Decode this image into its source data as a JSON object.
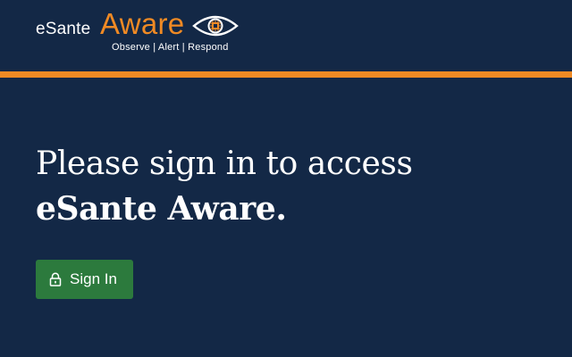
{
  "brand": {
    "prefix": "eSante",
    "name": "Aware",
    "tagline": "Observe | Alert | Respond",
    "colors": {
      "accent": "#f08a24",
      "background": "#132846",
      "button": "#2c7a3d"
    }
  },
  "main": {
    "heading_line1": "Please sign in to access",
    "heading_line2": "eSante Aware.",
    "signin_label": "Sign In",
    "signin_icon": "lock-icon"
  }
}
